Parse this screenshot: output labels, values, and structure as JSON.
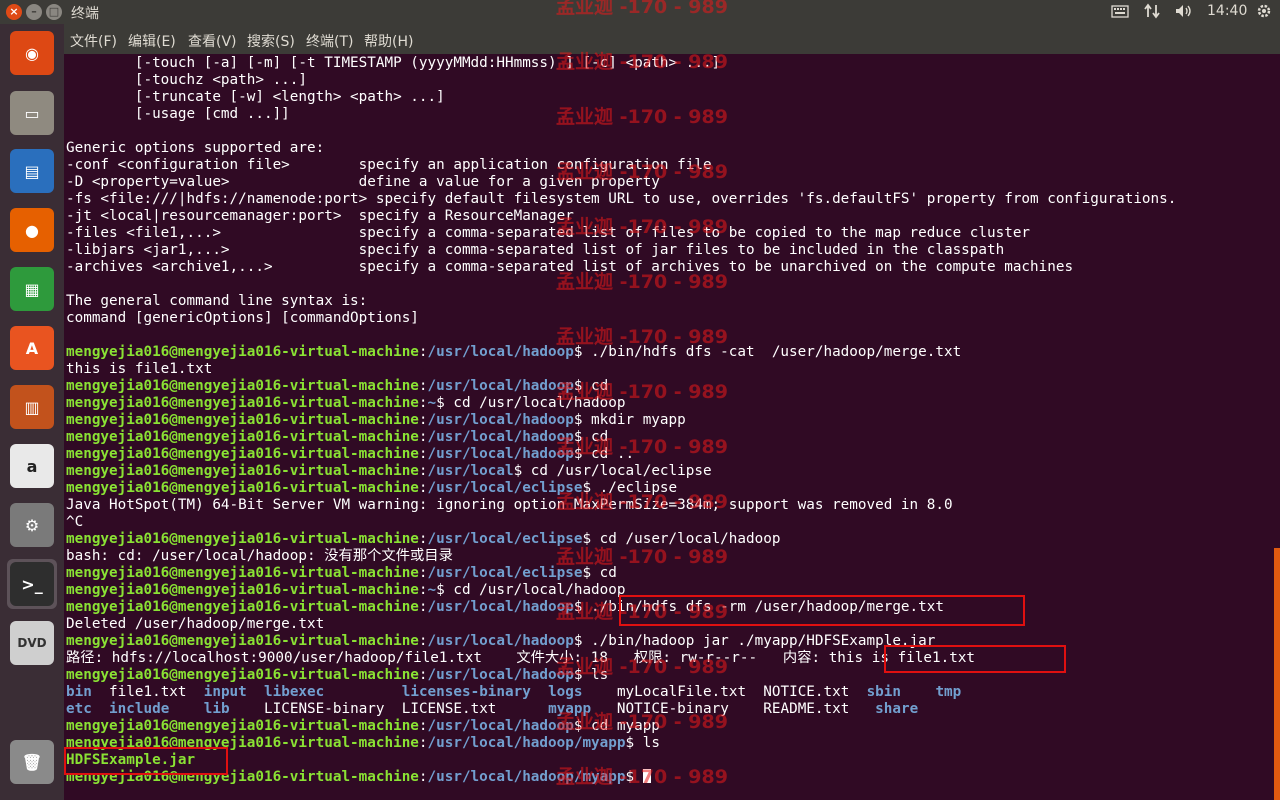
{
  "window": {
    "title": "终端",
    "close_glyph": "×",
    "min_glyph": "–",
    "max_glyph": "□",
    "clock": "14:40"
  },
  "menu": [
    "文件(F)",
    "编辑(E)",
    "查看(V)",
    "搜索(S)",
    "终端(T)",
    "帮助(H)"
  ],
  "launcher": [
    {
      "name": "ubuntu-logo-icon",
      "glyph": "◉",
      "color": "#dd4814"
    },
    {
      "name": "files-icon",
      "glyph": "▭",
      "color": "#8f8a80"
    },
    {
      "name": "writer-icon",
      "glyph": "▤",
      "color": "#2a6fbd"
    },
    {
      "name": "firefox-icon",
      "glyph": "●",
      "color": "#e66000"
    },
    {
      "name": "calc-icon",
      "glyph": "▦",
      "color": "#2e9a3c"
    },
    {
      "name": "software-center-icon",
      "glyph": "A",
      "color": "#e95420"
    },
    {
      "name": "impress-icon",
      "glyph": "▥",
      "color": "#c2521c"
    },
    {
      "name": "amazon-icon",
      "glyph": "a",
      "color": "#e9e9e9"
    },
    {
      "name": "settings-icon",
      "glyph": "⚙",
      "color": "#7a7a7a"
    },
    {
      "name": "terminal-icon",
      "glyph": ">_",
      "color": "#2e2e2e"
    },
    {
      "name": "dvd-icon",
      "glyph": "DVD",
      "color": "#cfcfcf"
    },
    {
      "name": "trash-icon",
      "glyph": "🗑",
      "color": "#8a8a8a"
    }
  ],
  "terminal": {
    "user": "mengyejia016@mengyejia016-virtual-machine",
    "lines": [
      [
        {
          "t": "        [-touch [-a] [-m] [-t TIMESTAMP (yyyyMMdd:HHmmss) ] [-c] <path> ...]"
        }
      ],
      [
        {
          "t": "        [-touchz <path> ...]"
        }
      ],
      [
        {
          "t": "        [-truncate [-w] <length> <path> ...]"
        }
      ],
      [
        {
          "t": "        [-usage [cmd ...]]"
        }
      ],
      [
        {
          "t": ""
        }
      ],
      [
        {
          "t": "Generic options supported are:"
        }
      ],
      [
        {
          "t": "-conf <configuration file>        specify an application configuration file"
        }
      ],
      [
        {
          "t": "-D <property=value>               define a value for a given property"
        }
      ],
      [
        {
          "t": "-fs <file:///|hdfs://namenode:port> specify default filesystem URL to use, overrides 'fs.defaultFS' property from configurations."
        }
      ],
      [
        {
          "t": "-jt <local|resourcemanager:port>  specify a ResourceManager"
        }
      ],
      [
        {
          "t": "-files <file1,...>                specify a comma-separated list of files to be copied to the map reduce cluster"
        }
      ],
      [
        {
          "t": "-libjars <jar1,...>               specify a comma-separated list of jar files to be included in the classpath"
        }
      ],
      [
        {
          "t": "-archives <archive1,...>          specify a comma-separated list of archives to be unarchived on the compute machines"
        }
      ],
      [
        {
          "t": ""
        }
      ],
      [
        {
          "t": "The general command line syntax is:"
        }
      ],
      [
        {
          "t": "command [genericOptions] [commandOptions]"
        }
      ],
      [
        {
          "t": ""
        }
      ],
      [
        {
          "t": "mengyejia016@mengyejia016-virtual-machine",
          "c": "u"
        },
        {
          "t": ":"
        },
        {
          "t": "/usr/local/hadoop",
          "c": "p"
        },
        {
          "t": "$ ./bin/hdfs dfs -cat  /user/hadoop/merge.txt"
        }
      ],
      [
        {
          "t": "this is file1.txt"
        }
      ],
      [
        {
          "t": "mengyejia016@mengyejia016-virtual-machine",
          "c": "u"
        },
        {
          "t": ":"
        },
        {
          "t": "/usr/local/hadoop",
          "c": "p"
        },
        {
          "t": "$ cd"
        }
      ],
      [
        {
          "t": "mengyejia016@mengyejia016-virtual-machine",
          "c": "u"
        },
        {
          "t": ":"
        },
        {
          "t": "~",
          "c": "p"
        },
        {
          "t": "$ cd /usr/local/hadoop"
        }
      ],
      [
        {
          "t": "mengyejia016@mengyejia016-virtual-machine",
          "c": "u"
        },
        {
          "t": ":"
        },
        {
          "t": "/usr/local/hadoop",
          "c": "p"
        },
        {
          "t": "$ mkdir myapp"
        }
      ],
      [
        {
          "t": "mengyejia016@mengyejia016-virtual-machine",
          "c": "u"
        },
        {
          "t": ":"
        },
        {
          "t": "/usr/local/hadoop",
          "c": "p"
        },
        {
          "t": "$ cd"
        }
      ],
      [
        {
          "t": "mengyejia016@mengyejia016-virtual-machine",
          "c": "u"
        },
        {
          "t": ":"
        },
        {
          "t": "/usr/local/hadoop",
          "c": "p"
        },
        {
          "t": "$ cd .."
        }
      ],
      [
        {
          "t": "mengyejia016@mengyejia016-virtual-machine",
          "c": "u"
        },
        {
          "t": ":"
        },
        {
          "t": "/usr/local",
          "c": "p"
        },
        {
          "t": "$ cd /usr/local/eclipse"
        }
      ],
      [
        {
          "t": "mengyejia016@mengyejia016-virtual-machine",
          "c": "u"
        },
        {
          "t": ":"
        },
        {
          "t": "/usr/local/eclipse",
          "c": "p"
        },
        {
          "t": "$ ./eclipse"
        }
      ],
      [
        {
          "t": "Java HotSpot(TM) 64-Bit Server VM warning: ignoring option MaxPermSize=384m; support was removed in 8.0"
        }
      ],
      [
        {
          "t": "^C"
        }
      ],
      [
        {
          "t": "mengyejia016@mengyejia016-virtual-machine",
          "c": "u"
        },
        {
          "t": ":"
        },
        {
          "t": "/usr/local/eclipse",
          "c": "p"
        },
        {
          "t": "$ cd /user/local/hadoop"
        }
      ],
      [
        {
          "t": "bash: cd: /user/local/hadoop: 没有那个文件或目录"
        }
      ],
      [
        {
          "t": "mengyejia016@mengyejia016-virtual-machine",
          "c": "u"
        },
        {
          "t": ":"
        },
        {
          "t": "/usr/local/eclipse",
          "c": "p"
        },
        {
          "t": "$ cd"
        }
      ],
      [
        {
          "t": "mengyejia016@mengyejia016-virtual-machine",
          "c": "u"
        },
        {
          "t": ":"
        },
        {
          "t": "~",
          "c": "p"
        },
        {
          "t": "$ cd /usr/local/hadoop"
        }
      ],
      [
        {
          "t": "mengyejia016@mengyejia016-virtual-machine",
          "c": "u"
        },
        {
          "t": ":"
        },
        {
          "t": "/usr/local/hadoop",
          "c": "p"
        },
        {
          "t": "$ ./bin/hdfs dfs -rm /user/hadoop/merge.txt"
        }
      ],
      [
        {
          "t": "Deleted /user/hadoop/merge.txt"
        }
      ],
      [
        {
          "t": "mengyejia016@mengyejia016-virtual-machine",
          "c": "u"
        },
        {
          "t": ":"
        },
        {
          "t": "/usr/local/hadoop",
          "c": "p"
        },
        {
          "t": "$ ./bin/hadoop jar ./myapp/HDFSExample.jar"
        }
      ],
      [
        {
          "t": "路径: hdfs://localhost:9000/user/hadoop/file1.txt    文件大小: 18   权限: rw-r--r--   内容: this is file1.txt"
        }
      ],
      [
        {
          "t": "mengyejia016@mengyejia016-virtual-machine",
          "c": "u"
        },
        {
          "t": ":"
        },
        {
          "t": "/usr/local/hadoop",
          "c": "p"
        },
        {
          "t": "$ ls"
        }
      ],
      [
        {
          "t": "bin",
          "c": "d"
        },
        {
          "t": "  file1.txt  "
        },
        {
          "t": "input",
          "c": "d"
        },
        {
          "t": "  "
        },
        {
          "t": "libexec",
          "c": "d"
        },
        {
          "t": "         "
        },
        {
          "t": "licenses-binary",
          "c": "d"
        },
        {
          "t": "  "
        },
        {
          "t": "logs",
          "c": "d"
        },
        {
          "t": "    myLocalFile.txt  NOTICE.txt  "
        },
        {
          "t": "sbin",
          "c": "d"
        },
        {
          "t": "    "
        },
        {
          "t": "tmp",
          "c": "d"
        }
      ],
      [
        {
          "t": "etc",
          "c": "d"
        },
        {
          "t": "  "
        },
        {
          "t": "include",
          "c": "d"
        },
        {
          "t": "    "
        },
        {
          "t": "lib",
          "c": "d"
        },
        {
          "t": "    LICENSE-binary  LICENSE.txt      "
        },
        {
          "t": "myapp",
          "c": "d"
        },
        {
          "t": "   NOTICE-binary    README.txt   "
        },
        {
          "t": "share",
          "c": "d"
        }
      ],
      [
        {
          "t": "mengyejia016@mengyejia016-virtual-machine",
          "c": "u"
        },
        {
          "t": ":"
        },
        {
          "t": "/usr/local/hadoop",
          "c": "p"
        },
        {
          "t": "$ cd myapp"
        }
      ],
      [
        {
          "t": "mengyejia016@mengyejia016-virtual-machine",
          "c": "u"
        },
        {
          "t": ":"
        },
        {
          "t": "/usr/local/hadoop/myapp",
          "c": "p"
        },
        {
          "t": "$ ls"
        }
      ],
      [
        {
          "t": "HDFSExample.jar",
          "c": "u"
        }
      ],
      [
        {
          "t": "mengyejia016@mengyejia016-virtual-machine",
          "c": "u"
        },
        {
          "t": ":"
        },
        {
          "t": "/usr/local/hadoop/myapp",
          "c": "p"
        },
        {
          "t": "$ "
        },
        {
          "t": "",
          "c": "cursor"
        }
      ]
    ]
  },
  "watermark": "孟业迦 -170 - 989",
  "colors": {
    "terminal_bg": "#300a24",
    "user_green": "#8ae234",
    "path_blue": "#729fcf",
    "highlight_red": "#e01010",
    "panel": "#3c3b37"
  }
}
